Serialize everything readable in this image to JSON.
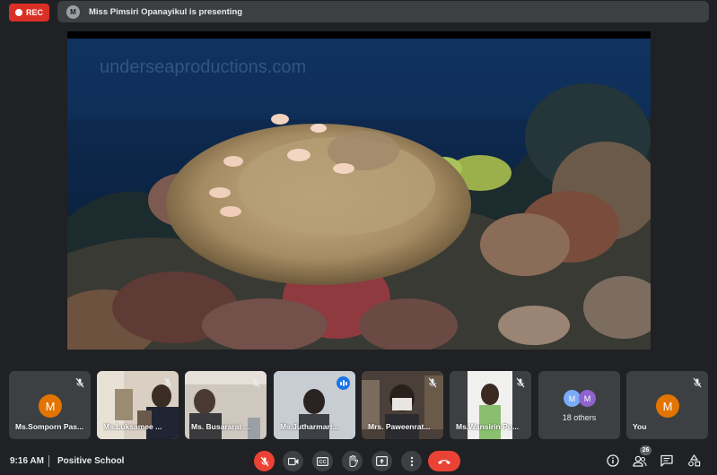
{
  "recording": {
    "label": "REC"
  },
  "presentation": {
    "avatar_initial": "M",
    "banner": "Miss Pimsiri Opanayikul is presenting",
    "watermark": "underseaproductions.com"
  },
  "participants": [
    {
      "name": "Ms.Somporn Pas...",
      "initial": "M",
      "muted": true,
      "video": false
    },
    {
      "name": "Ms.Luksamee ...",
      "muted": true,
      "video": true
    },
    {
      "name": "Ms. Busararat ...",
      "muted": true,
      "video": true
    },
    {
      "name": "Ms.Jutharmart...",
      "muted": false,
      "speaking": true,
      "video": true
    },
    {
      "name": "Mrs. Paweenrat...",
      "muted": true,
      "video": true
    },
    {
      "name": "Ms.Wansirin Po...",
      "muted": true,
      "video": true
    }
  ],
  "others": {
    "label": "18 others",
    "initials": [
      "M",
      "M"
    ],
    "colors": [
      "#7baaf7",
      "#8e63ce"
    ]
  },
  "self": {
    "name": "You",
    "initial": "M",
    "muted": true
  },
  "bottom_bar": {
    "time": "9:16 AM",
    "meeting_name": "Positive School",
    "people_count": "26"
  },
  "colors": {
    "background": "#202124",
    "tile": "#3c4043",
    "danger": "#ea4335",
    "accent": "#1a73e8",
    "avatar": "#e37400"
  }
}
